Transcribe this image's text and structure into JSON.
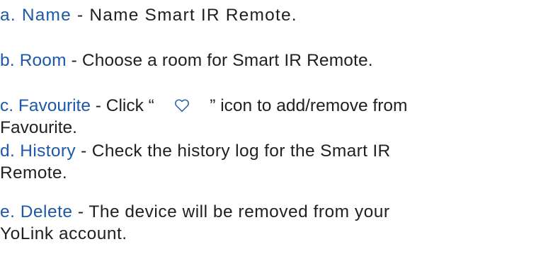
{
  "items": [
    {
      "label": "a. Name",
      "text": " - Name Smart IR Remote."
    },
    {
      "label": "b. Room",
      "text": " - Choose a room for Smart IR Remote."
    },
    {
      "label": "c. Favourite",
      "text_before": " - Click “    ",
      "icon": "heart-outline-icon",
      "text_after": "    ” icon to add/remove from",
      "line2": "Favourite."
    },
    {
      "label": "d. History",
      "text": " - Check the history log for the Smart IR",
      "line2": "Remote."
    },
    {
      "label": "e. Delete",
      "text": " - The device will be removed from your",
      "line2": "YoLink account."
    }
  ],
  "colors": {
    "label": "#1e59a8",
    "body_text": "#231f20",
    "icon_stroke": "#1e59a8",
    "background": "#ffffff"
  }
}
